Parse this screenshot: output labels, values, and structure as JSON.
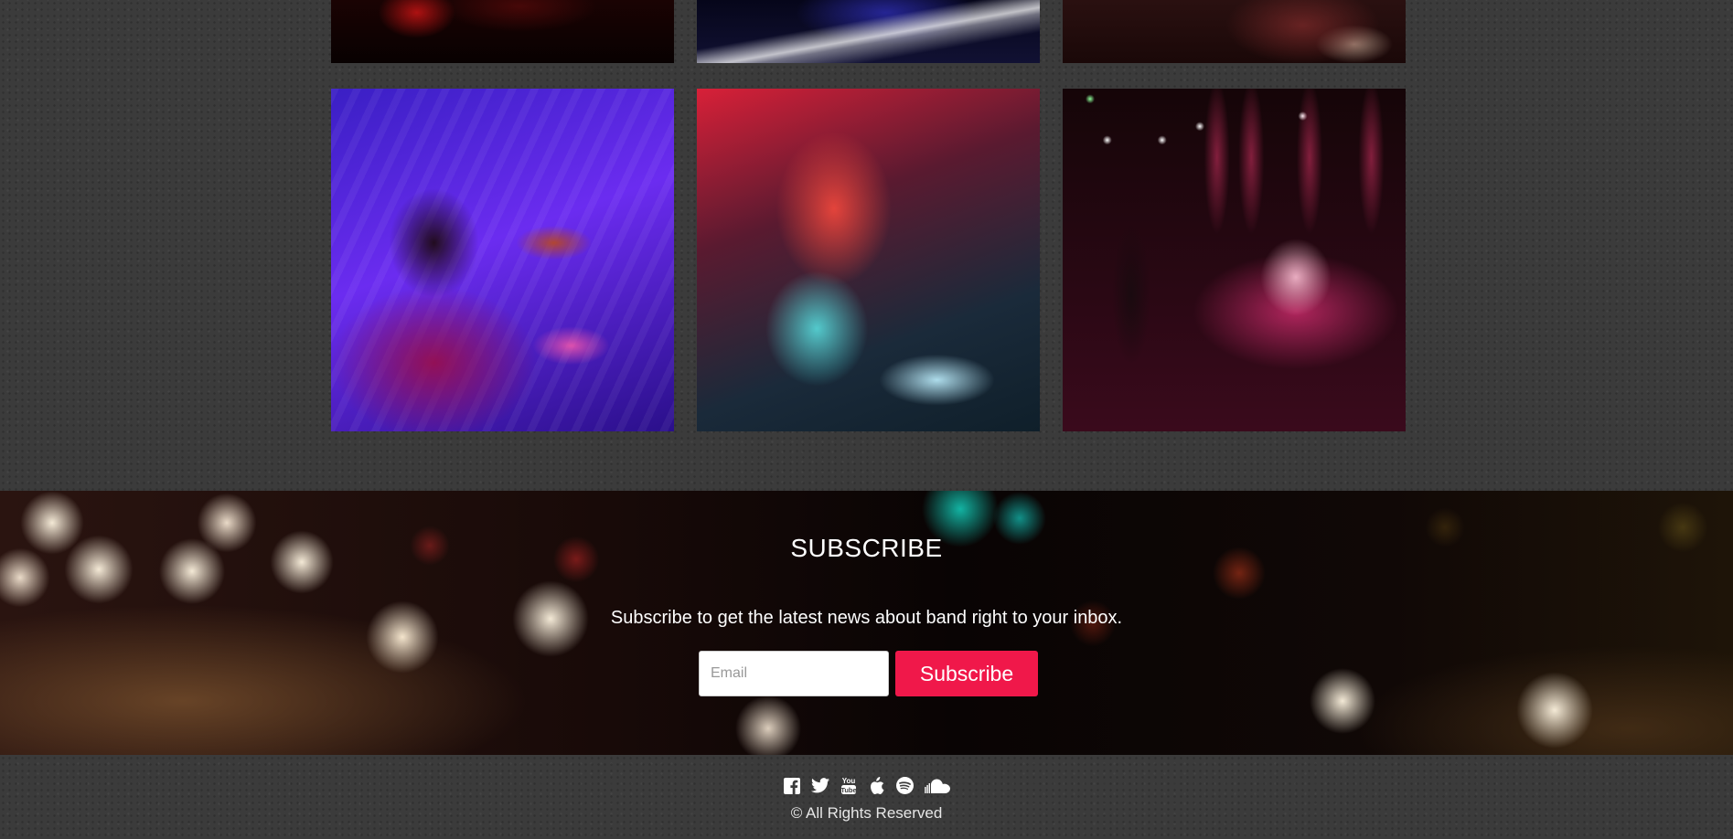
{
  "gallery": {
    "top_row": [
      {
        "icon": "concert-photo"
      },
      {
        "icon": "keyboard-stage-photo"
      },
      {
        "icon": "drum-stage-photo"
      }
    ],
    "main_row": [
      {
        "icon": "drummer-photo"
      },
      {
        "icon": "guitarist-headbang-photo"
      },
      {
        "icon": "singer-skull-stage-photo"
      }
    ]
  },
  "subscribe": {
    "title": "SUBSCRIBE",
    "description": "Subscribe to get the latest news about band right to your inbox.",
    "email_placeholder": "Email",
    "email_value": "",
    "button_label": "Subscribe",
    "button_color": "#f0184a"
  },
  "footer": {
    "social_icons": [
      "facebook-icon",
      "twitter-icon",
      "youtube-icon",
      "apple-icon",
      "spotify-icon",
      "soundcloud-icon"
    ],
    "copyright": "© All Rights Reserved"
  }
}
